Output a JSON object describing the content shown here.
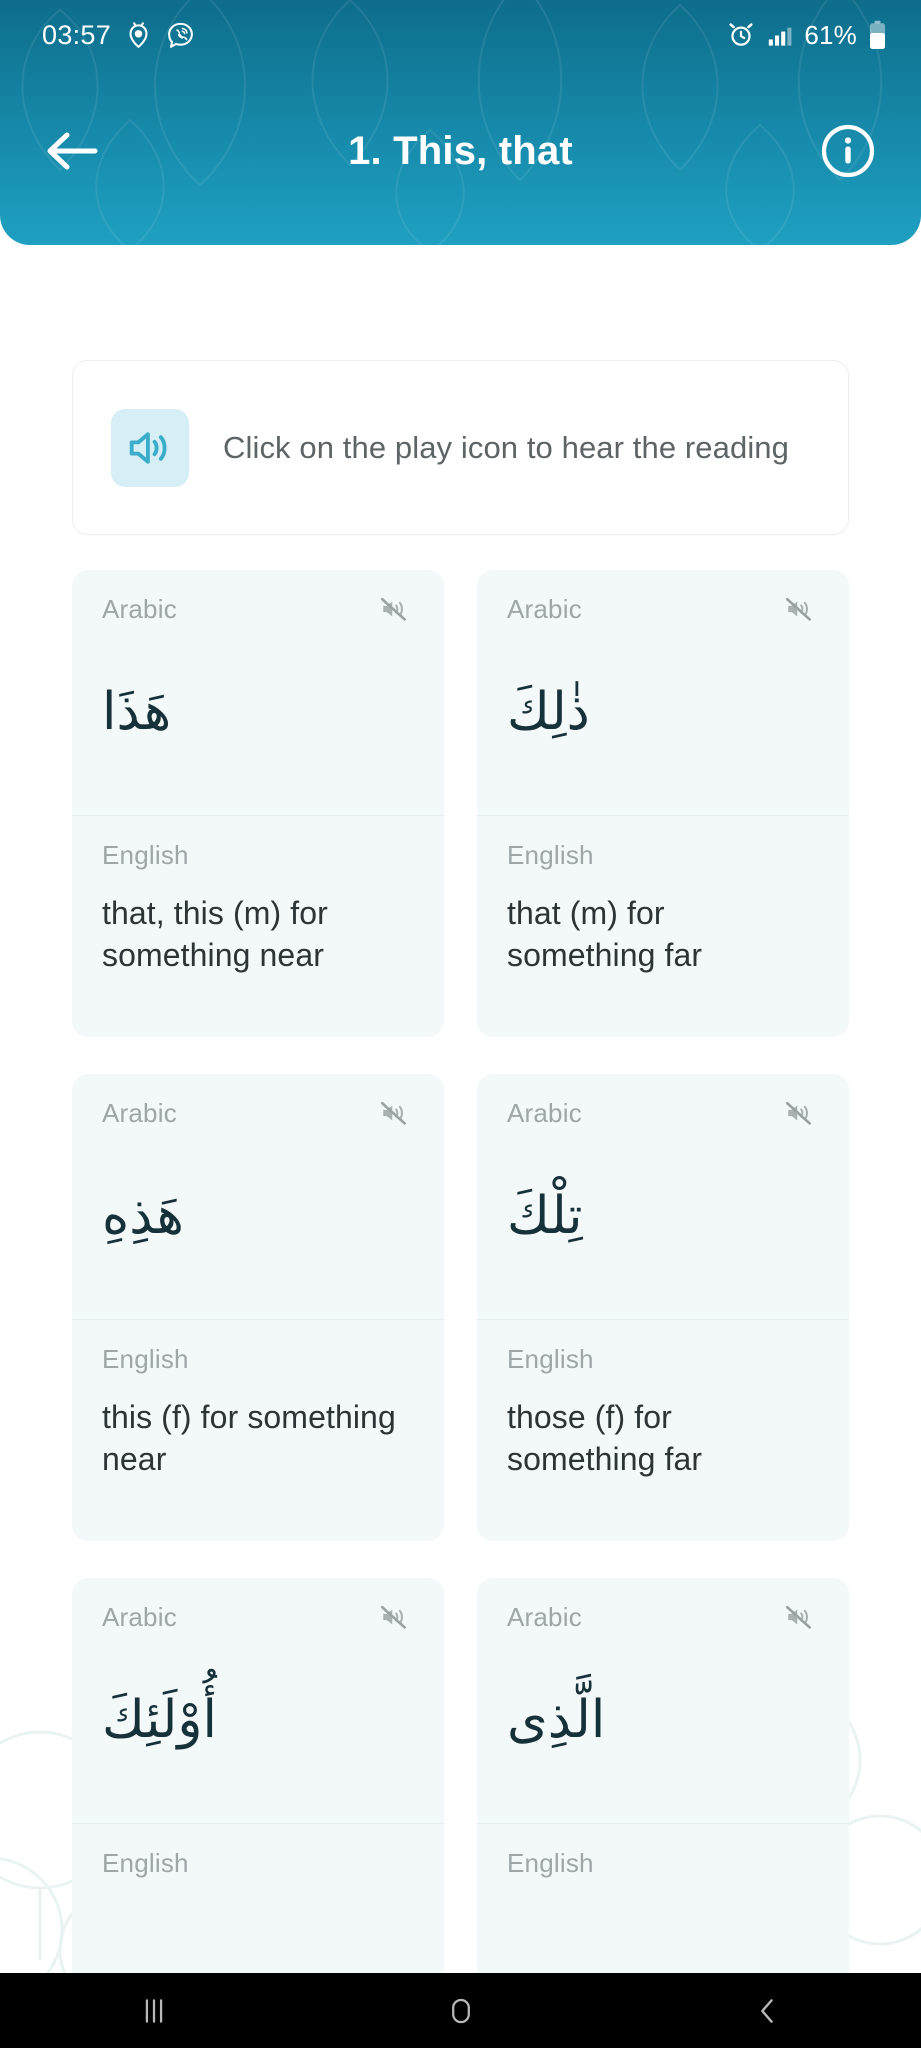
{
  "status_bar": {
    "time": "03:57",
    "battery_percent": "61%",
    "left_icons": [
      "alarm-timer-icon",
      "viber-call-icon"
    ],
    "right_icons": [
      "alarm-clock-icon",
      "signal-bars-icon",
      "battery-icon"
    ]
  },
  "header": {
    "title": "1. This, that",
    "back_icon": "arrow-left-icon",
    "info_icon": "info-circle-icon",
    "gradient_top": "#0e6d8b",
    "gradient_bottom": "#1fa0c0"
  },
  "hint": {
    "icon": "speaker-on-icon",
    "icon_color": "#3aadca",
    "icon_bg": "#d6eef5",
    "text": "Click on the play icon to hear the reading"
  },
  "cards": {
    "arabic_label": "Arabic",
    "english_label": "English",
    "mute_icon": "speaker-muted-icon",
    "items": [
      {
        "arabic": "هَذَا",
        "english": "that, this (m) for something near"
      },
      {
        "arabic": "ذٰلِكَ",
        "english": "that (m) for something far"
      },
      {
        "arabic": "هَذِهِ",
        "english": "this (f) for something near"
      },
      {
        "arabic": "تِلْكَ",
        "english": "those (f) for something far"
      },
      {
        "arabic": "أُوْلَئِكَ",
        "english": ""
      },
      {
        "arabic": "الَّذِى",
        "english": ""
      }
    ]
  },
  "nav_bar": {
    "recents_icon": "recents-bars-icon",
    "home_icon": "home-circle-icon",
    "back_icon": "back-chevron-icon"
  }
}
